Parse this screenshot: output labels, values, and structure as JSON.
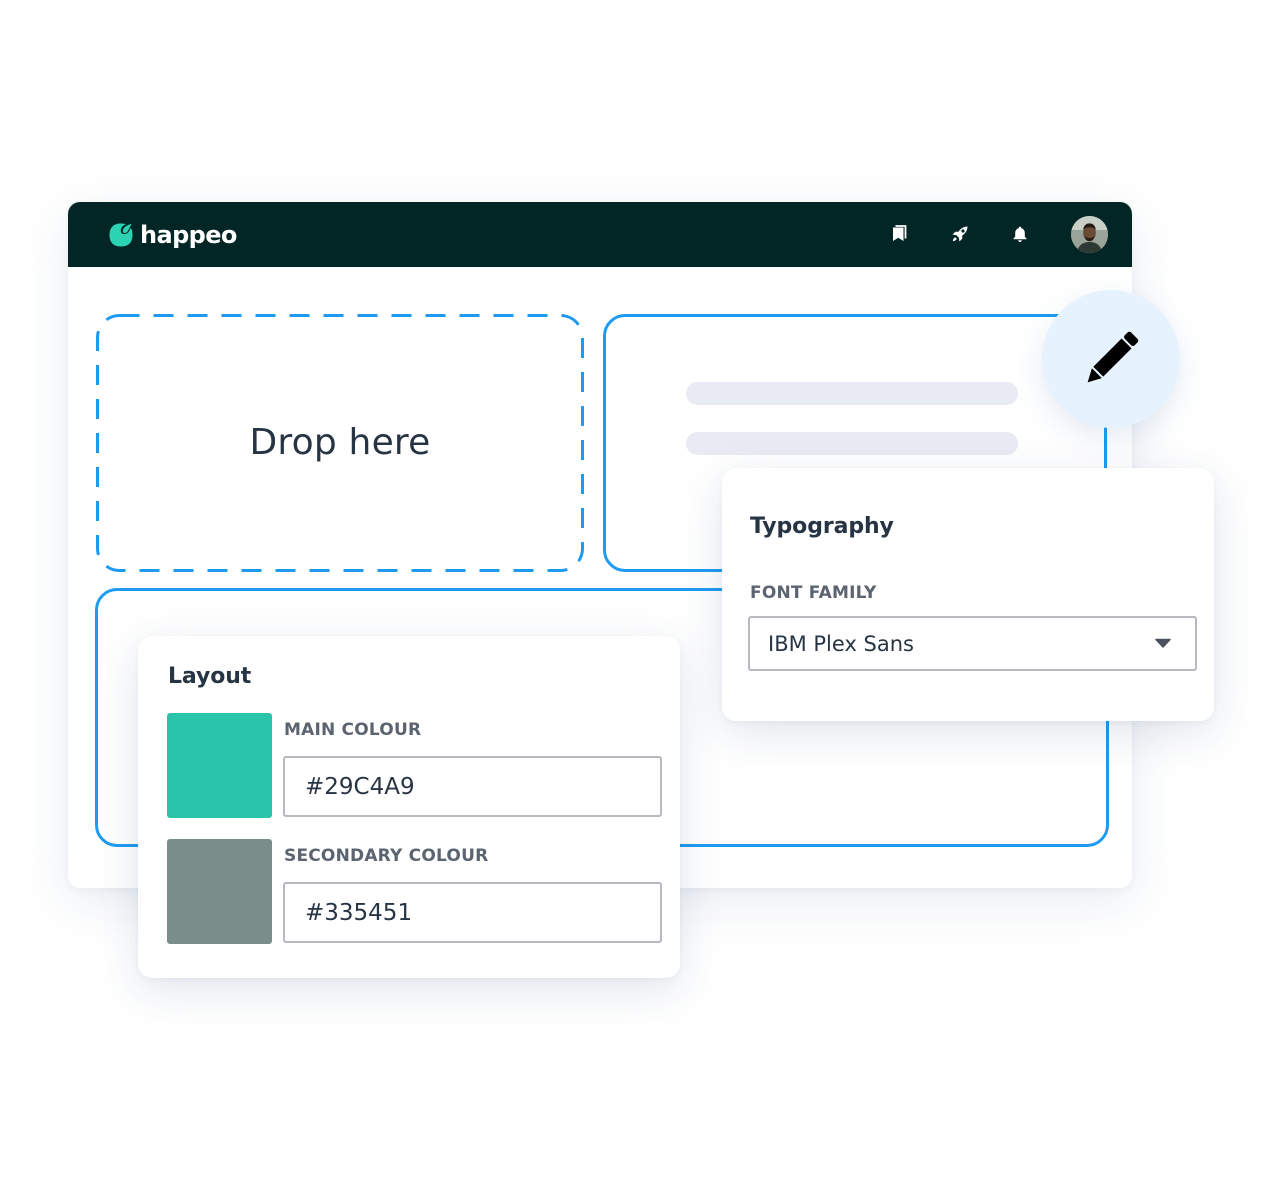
{
  "app": {
    "brand_name": "happeo",
    "brand_color": "#022625",
    "accent_color": "#2cd3b3"
  },
  "topbar": {
    "icons": [
      {
        "name": "bookmark-icon"
      },
      {
        "name": "rocket-icon"
      },
      {
        "name": "bell-icon"
      }
    ],
    "avatar": {
      "name": "user-avatar"
    }
  },
  "drop_zone": {
    "label": "Drop here"
  },
  "edit_button": {
    "icon": "pencil-icon"
  },
  "typography_panel": {
    "title": "Typography",
    "font_family_label": "FONT FAMILY",
    "font_family_value": "IBM Plex Sans",
    "dropdown_icon": "caret-down-icon"
  },
  "layout_panel": {
    "title": "Layout",
    "main_colour_label": "MAIN COLOUR",
    "main_colour_value": "#29C4A9",
    "secondary_colour_label": "SECONDARY COLOUR",
    "secondary_colour_value": "#335451",
    "main_swatch_color": "#29C4A9",
    "secondary_swatch_color": "#7a8d89"
  },
  "colors": {
    "outline_blue": "#1e9bf0",
    "skeleton": "#e9ebf4",
    "edit_circle": "#e6f2fd"
  }
}
